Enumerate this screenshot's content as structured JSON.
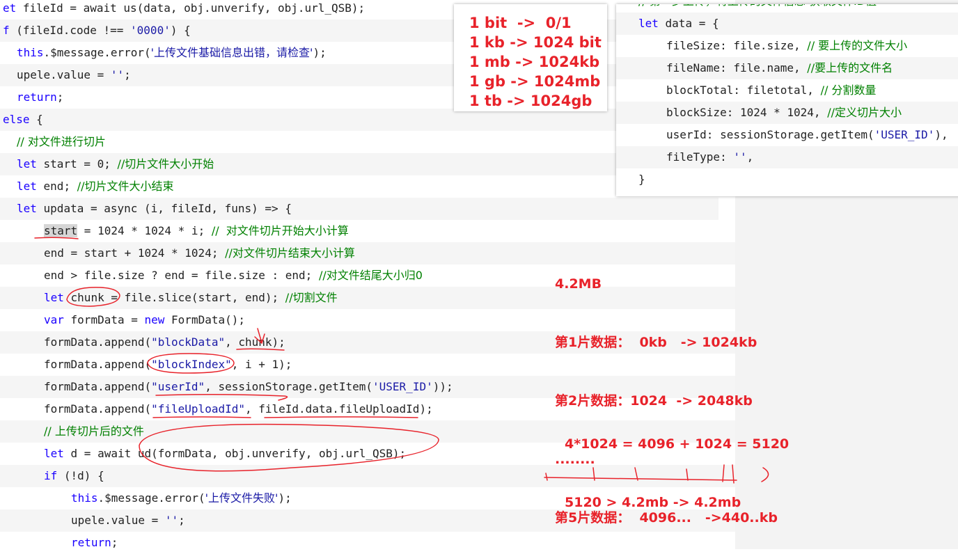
{
  "code": [
    {
      "indent": 0,
      "alt": false,
      "parts": [
        [
          "kw",
          "et "
        ],
        [
          "plain",
          "fileId = await us(data, obj.unverify, obj.url_QSB);"
        ]
      ]
    },
    {
      "indent": 0,
      "alt": true,
      "parts": [
        [
          "kw",
          "f "
        ],
        [
          "plain",
          "(fileId.code !== "
        ],
        [
          "str",
          "'0000'"
        ],
        [
          "plain",
          ") {"
        ]
      ]
    },
    {
      "indent": 1,
      "alt": false,
      "parts": [
        [
          "kw",
          "this"
        ],
        [
          "plain",
          ".$message.error("
        ],
        [
          "str",
          "'上传文件基础信息出错，请检查'"
        ],
        [
          "plain",
          ");"
        ]
      ]
    },
    {
      "indent": 1,
      "alt": true,
      "parts": [
        [
          "plain",
          "upele.value = "
        ],
        [
          "str",
          "''"
        ],
        [
          "plain",
          ";"
        ]
      ]
    },
    {
      "indent": 1,
      "alt": false,
      "parts": [
        [
          "kw",
          "return"
        ],
        [
          "plain",
          ";"
        ]
      ]
    },
    {
      "indent": 0,
      "alt": true,
      "parts": [
        [
          "kw",
          "else"
        ],
        [
          "plain",
          " {"
        ]
      ]
    },
    {
      "indent": 1,
      "alt": false,
      "parts": [
        [
          "cm",
          "// 对文件进行切片"
        ]
      ]
    },
    {
      "indent": 1,
      "alt": true,
      "parts": [
        [
          "kw",
          "let"
        ],
        [
          "plain",
          " start = 0; "
        ],
        [
          "cm",
          "//切片文件大小开始"
        ]
      ]
    },
    {
      "indent": 1,
      "alt": false,
      "parts": [
        [
          "kw",
          "let"
        ],
        [
          "plain",
          " end; "
        ],
        [
          "cm",
          "//切片文件大小结束"
        ]
      ]
    },
    {
      "indent": 1,
      "alt": true,
      "parts": [
        [
          "kw",
          "let"
        ],
        [
          "plain",
          " updata = async (i, fileId, funs) => {"
        ]
      ]
    },
    {
      "indent": 2,
      "alt": false,
      "parts": [
        [
          "hl",
          "start"
        ],
        [
          "plain",
          " = 1024 * 1024 * i; "
        ],
        [
          "cm",
          "//  对文件切片开始大小计算"
        ]
      ]
    },
    {
      "indent": 2,
      "alt": true,
      "parts": [
        [
          "plain",
          "end = start + 1024 * 1024; "
        ],
        [
          "cm",
          "//对文件切片结束大小计算"
        ]
      ]
    },
    {
      "indent": 2,
      "alt": false,
      "parts": [
        [
          "plain",
          "end > file.size ? end = file.size : end; "
        ],
        [
          "cm",
          "//对文件结尾大小归0"
        ]
      ]
    },
    {
      "indent": 2,
      "alt": true,
      "parts": [
        [
          "kw",
          "let"
        ],
        [
          "plain",
          " chunk = file.slice(start, end); "
        ],
        [
          "cm",
          "//切割文件"
        ]
      ]
    },
    {
      "indent": 2,
      "alt": false,
      "parts": [
        [
          "kw",
          "var"
        ],
        [
          "plain",
          " formData = "
        ],
        [
          "kw",
          "new"
        ],
        [
          "plain",
          " FormData();"
        ]
      ]
    },
    {
      "indent": 2,
      "alt": true,
      "parts": [
        [
          "plain",
          "formData.append("
        ],
        [
          "str",
          "\"blockData\""
        ],
        [
          "plain",
          ", chunk);"
        ]
      ]
    },
    {
      "indent": 2,
      "alt": false,
      "parts": [
        [
          "plain",
          "formData.append("
        ],
        [
          "str",
          "\"blockIndex\""
        ],
        [
          "plain",
          ", i + 1);"
        ]
      ]
    },
    {
      "indent": 2,
      "alt": true,
      "parts": [
        [
          "plain",
          "formData.append("
        ],
        [
          "str",
          "\"userId\""
        ],
        [
          "plain",
          ", sessionStorage.getItem("
        ],
        [
          "str",
          "'USER_ID'"
        ],
        [
          "plain",
          "));"
        ]
      ]
    },
    {
      "indent": 2,
      "alt": false,
      "parts": [
        [
          "plain",
          "formData.append("
        ],
        [
          "str",
          "\"fileUploadId\""
        ],
        [
          "plain",
          ", fileId.data.fileUploadId);"
        ]
      ]
    },
    {
      "indent": 2,
      "alt": true,
      "parts": [
        [
          "cm",
          "// 上传切片后的文件"
        ]
      ]
    },
    {
      "indent": 2,
      "alt": false,
      "parts": [
        [
          "kw",
          "let"
        ],
        [
          "plain",
          " d = await ud(formData, obj.unverify, obj.url_QSB);"
        ]
      ]
    },
    {
      "indent": 2,
      "alt": true,
      "parts": [
        [
          "kw",
          "if"
        ],
        [
          "plain",
          " (!d) {"
        ]
      ]
    },
    {
      "indent": 3,
      "alt": false,
      "parts": [
        [
          "kw",
          "this"
        ],
        [
          "plain",
          ".$message.error("
        ],
        [
          "str",
          "'上传文件失败'"
        ],
        [
          "plain",
          ");"
        ]
      ]
    },
    {
      "indent": 3,
      "alt": true,
      "parts": [
        [
          "plain",
          "upele.value = "
        ],
        [
          "str",
          "''"
        ],
        [
          "plain",
          ";"
        ]
      ]
    },
    {
      "indent": 3,
      "alt": false,
      "parts": [
        [
          "kw",
          "return"
        ],
        [
          "plain",
          ";"
        ]
      ]
    }
  ],
  "sizes_panel": {
    "lines": [
      "1 bit  ->  0/1",
      "1 kb -> 1024 bit",
      "1 mb -> 1024kb",
      "1 gb -> 1024mb",
      "1 tb -> 1024gb"
    ]
  },
  "data_panel": {
    "lines": [
      {
        "alt": false,
        "indent": 1,
        "parts": [
          [
            "cm",
            "// 第一步上传，将上传的文件信息 获取文件ID值"
          ]
        ]
      },
      {
        "alt": true,
        "indent": 1,
        "parts": [
          [
            "kw",
            "let"
          ],
          [
            "plain",
            " data = {"
          ]
        ]
      },
      {
        "alt": false,
        "indent": 2,
        "parts": [
          [
            "plain",
            "fileSize: file.size, "
          ],
          [
            "cm",
            "// 要上传的文件大小"
          ]
        ]
      },
      {
        "alt": true,
        "indent": 2,
        "parts": [
          [
            "plain",
            "fileName: file.name, "
          ],
          [
            "cm",
            "//要上传的文件名"
          ]
        ]
      },
      {
        "alt": false,
        "indent": 2,
        "parts": [
          [
            "plain",
            "blockTotal: filetotal, "
          ],
          [
            "cm",
            "// 分割数量"
          ]
        ]
      },
      {
        "alt": true,
        "indent": 2,
        "parts": [
          [
            "plain",
            "blockSize: 1024 * 1024, "
          ],
          [
            "cm",
            "//定义切片大小"
          ]
        ]
      },
      {
        "alt": false,
        "indent": 2,
        "parts": [
          [
            "plain",
            "userId: sessionStorage.getItem("
          ],
          [
            "str",
            "'USER_ID'"
          ],
          [
            "plain",
            "),"
          ]
        ]
      },
      {
        "alt": true,
        "indent": 2,
        "parts": [
          [
            "plain",
            "fileType: "
          ],
          [
            "str",
            "''"
          ],
          [
            "plain",
            ","
          ]
        ]
      },
      {
        "alt": false,
        "indent": 1,
        "parts": [
          [
            "plain",
            "}"
          ]
        ]
      }
    ]
  },
  "notes": {
    "chunks": [
      "4.2MB",
      "第1片数据：  0kb   -> 1024kb",
      "第2片数据：1024  -> 2048kb",
      "........",
      "第5片数据：  4096...   ->440..kb"
    ],
    "calc": [
      "4*1024 = 4096 + 1024 = 5120",
      "5120 > 4.2mb -> 4.2mb"
    ]
  },
  "colors": {
    "annotation": "#e8222a",
    "keyword": "#1a00ff",
    "string": "#1a1aa6",
    "comment": "#008000"
  }
}
